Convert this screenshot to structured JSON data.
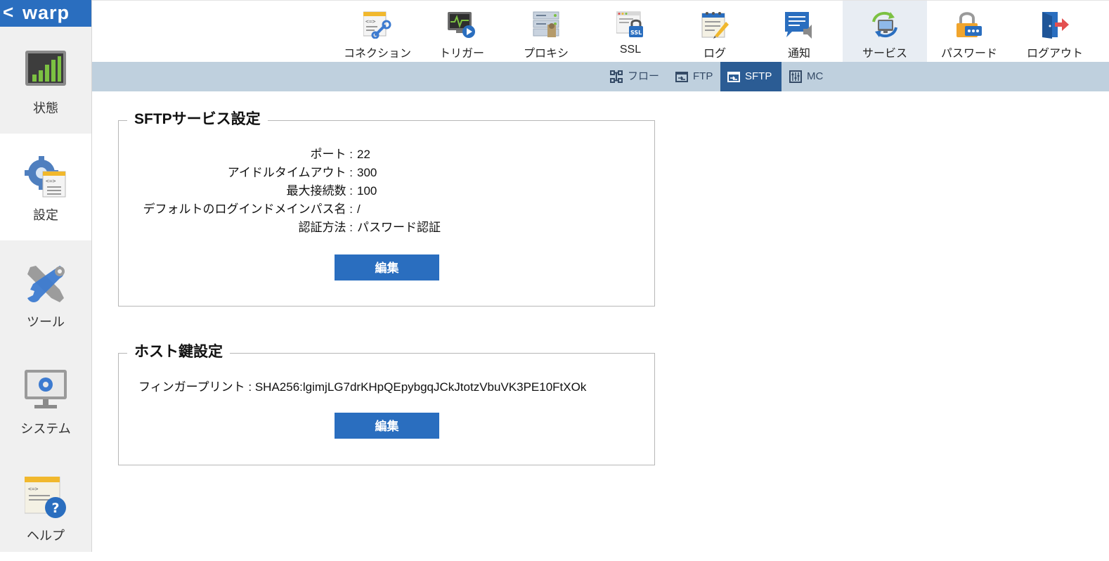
{
  "brand": {
    "back_symbol": "<",
    "name": "warp"
  },
  "sidebar": {
    "items": [
      {
        "label": "状態",
        "icon": "status-chart-icon"
      },
      {
        "label": "設定",
        "icon": "settings-gear-icon"
      },
      {
        "label": "ツール",
        "icon": "tools-wrench-icon"
      },
      {
        "label": "システム",
        "icon": "system-monitor-icon"
      },
      {
        "label": "ヘルプ",
        "icon": "help-icon"
      }
    ]
  },
  "topnav": {
    "tabs": [
      {
        "label": "コネクション",
        "icon": "connection-icon"
      },
      {
        "label": "トリガー",
        "icon": "trigger-icon"
      },
      {
        "label": "プロキシ",
        "icon": "proxy-icon"
      },
      {
        "label": "SSL",
        "icon": "ssl-icon"
      },
      {
        "label": "ログ",
        "icon": "log-icon"
      },
      {
        "label": "通知",
        "icon": "notification-icon"
      },
      {
        "label": "サービス",
        "icon": "service-icon"
      },
      {
        "label": "パスワード",
        "icon": "password-lock-icon"
      },
      {
        "label": "ログアウト",
        "icon": "logout-icon"
      }
    ],
    "active": "サービス"
  },
  "subnav": {
    "tabs": [
      {
        "label": "フロー",
        "icon": "flow-icon"
      },
      {
        "label": "FTP",
        "icon": "ftp-icon"
      },
      {
        "label": "SFTP",
        "icon": "sftp-icon"
      },
      {
        "label": "MC",
        "icon": "mc-icon"
      }
    ],
    "active": "SFTP"
  },
  "sftp_panel": {
    "title": "SFTPサービス設定",
    "rows": [
      {
        "label": "ポート :",
        "value": "22"
      },
      {
        "label": "アイドルタイムアウト :",
        "value": "300"
      },
      {
        "label": "最大接続数 :",
        "value": "100"
      },
      {
        "label": "デフォルトのログインドメインパス名 :",
        "value": "/"
      },
      {
        "label": "認証方法 :",
        "value": "パスワード認証"
      }
    ],
    "edit_label": "編集"
  },
  "hostkey_panel": {
    "title": "ホスト鍵設定",
    "fingerprint_label": "フィンガープリント :",
    "fingerprint_value": "SHA256:lgimjLG7drKHpQEpybgqJCkJtotzVbuVK3PE10FtXOk",
    "edit_label": "編集"
  },
  "colors": {
    "brand_blue": "#2a6ebf",
    "subnav_bg": "#bfd0de",
    "subnav_active": "#2b5c94",
    "tab_active_bg": "#e8edf3"
  }
}
